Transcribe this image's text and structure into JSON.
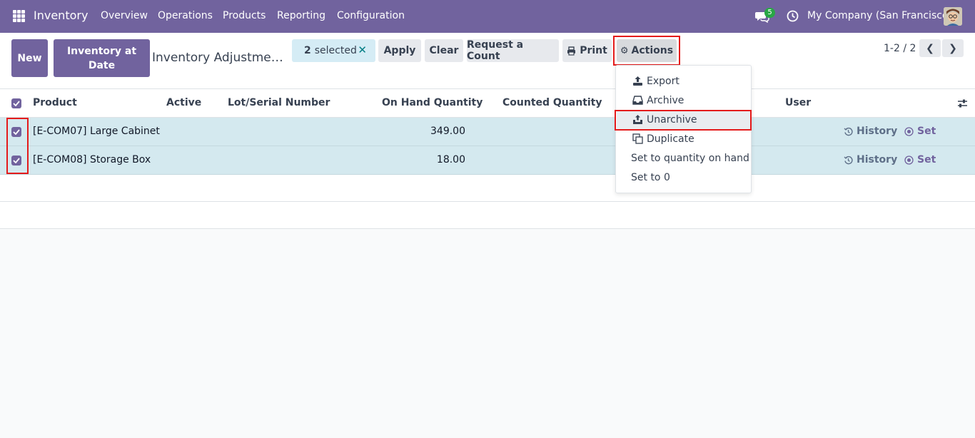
{
  "navbar": {
    "app_name": "Inventory",
    "menus": [
      "Overview",
      "Operations",
      "Products",
      "Reporting",
      "Configuration"
    ],
    "chat_badge": "5",
    "company": "My Company (San Francisco)"
  },
  "control": {
    "new_label": "New",
    "inventory_at_date_label": "Inventory at Date",
    "breadcrumb": "Inventory Adjustme…",
    "selected_count": "2",
    "selected_label": "selected",
    "apply_label": "Apply",
    "clear_label": "Clear",
    "request_count_label": "Request a Count",
    "print_label": "Print",
    "actions_label": "Actions",
    "pager": "1-2 / 2"
  },
  "table": {
    "columns": {
      "product": "Product",
      "active": "Active",
      "lot": "Lot/Serial Number",
      "on_hand": "On Hand Quantity",
      "counted": "Counted Quantity",
      "user": "User"
    },
    "rows": [
      {
        "product": "[E-COM07] Large Cabinet",
        "on_hand": "349.00",
        "history": "History",
        "set": "Set"
      },
      {
        "product": "[E-COM08] Storage Box",
        "on_hand": "18.00",
        "history": "History",
        "set": "Set"
      }
    ]
  },
  "actions_menu": {
    "items": [
      "Export",
      "Archive",
      "Unarchive",
      "Duplicate",
      "Set to quantity on hand",
      "Set to 0"
    ]
  },
  "colors": {
    "brand": "#71639e",
    "highlight": "#e41b1b",
    "selected_row": "#d4e9ef"
  }
}
